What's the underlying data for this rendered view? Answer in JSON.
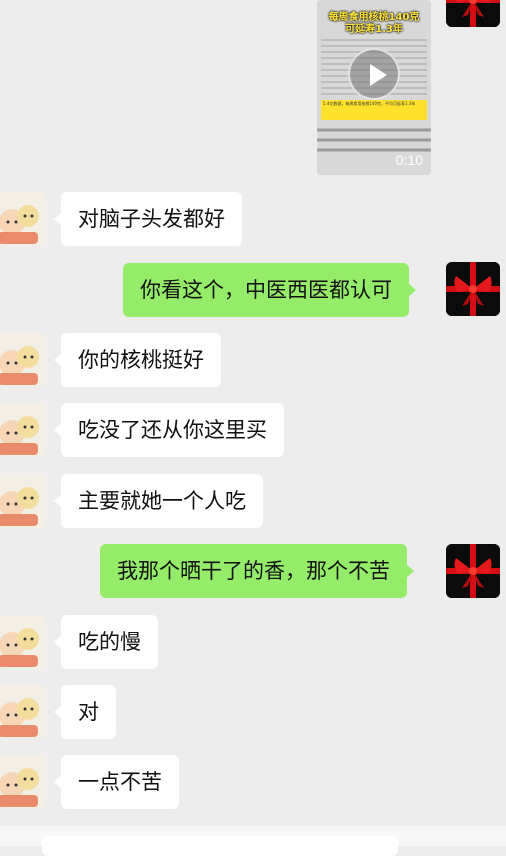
{
  "video_message": {
    "title_line1": "每周食用核桃140克",
    "title_line2": "可延寿1.3年",
    "caption": "5.4亿数据，每周食用核桃140克，平均可延寿1.3年",
    "duration": "0:10"
  },
  "messages": [
    {
      "sender": "contact",
      "text": "对脑子头发都好"
    },
    {
      "sender": "me",
      "text": "你看这个，中医西医都认可"
    },
    {
      "sender": "contact",
      "text": "你的核桃挺好"
    },
    {
      "sender": "contact",
      "text": "吃没了还从你这里买"
    },
    {
      "sender": "contact",
      "text": "主要就她一个人吃"
    },
    {
      "sender": "me",
      "text": "我那个晒干了的香，那个不苦"
    },
    {
      "sender": "contact",
      "text": "吃的慢"
    },
    {
      "sender": "contact",
      "text": "对"
    },
    {
      "sender": "contact",
      "text": "一点不苦"
    }
  ],
  "colors": {
    "background": "#ededed",
    "outgoing_bubble": "#95ec69",
    "incoming_bubble": "#ffffff"
  }
}
